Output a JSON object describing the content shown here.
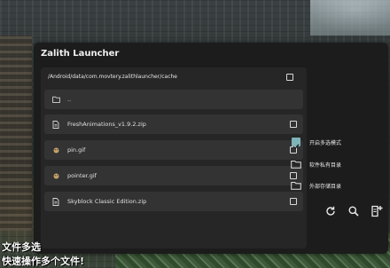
{
  "window": {
    "title": "Zalith Launcher"
  },
  "file_panel": {
    "path": "/Android/data/com.movtery.zalithlauncher/cache",
    "path_checked": false,
    "items": [
      {
        "icon": "folder-icon",
        "label": "..",
        "selectable": false
      },
      {
        "icon": "file-icon",
        "label": "FreshAnimations_v1.9.2.zip",
        "checked": false
      },
      {
        "icon": "gif-icon",
        "label": "pin.gif",
        "checked": false
      },
      {
        "icon": "gif-icon",
        "label": "pointer.gif",
        "checked": false
      },
      {
        "icon": "file-icon",
        "label": "Skyblock Classic Edition.zip",
        "checked": false
      }
    ]
  },
  "side_options": [
    {
      "icon": "checkbox-checked-icon",
      "label": "开启多选模式",
      "checked": true
    },
    {
      "icon": "folder-icon",
      "label": "软件私有目录"
    },
    {
      "icon": "folder-icon",
      "label": "外部存储目录"
    }
  ],
  "toolbar": [
    "refresh-icon",
    "search-icon",
    "add-file-icon"
  ],
  "accent_color": "#7fb3b8",
  "caption": {
    "line1": "文件多选",
    "line2": "快速操作多个文件!"
  }
}
